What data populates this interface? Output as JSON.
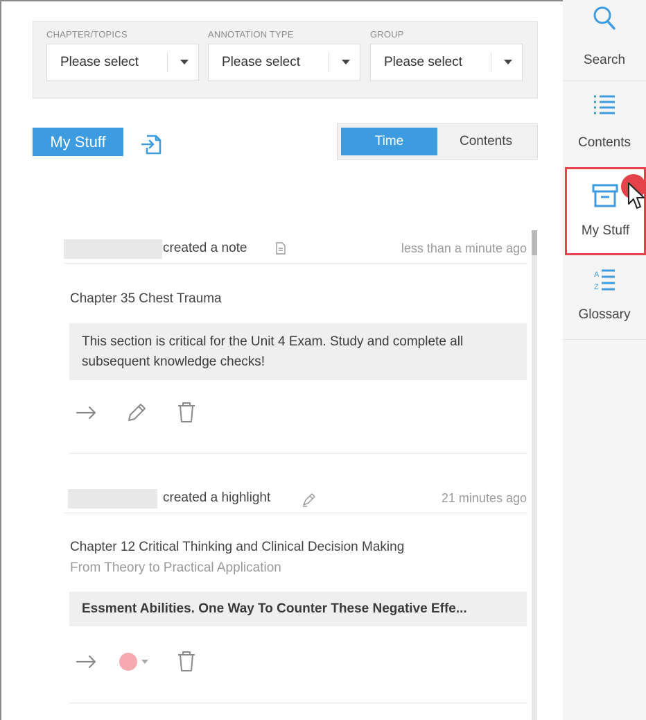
{
  "filters": [
    {
      "label": "CHAPTER/TOPICS",
      "value": "Please select"
    },
    {
      "label": "ANNOTATION TYPE",
      "value": "Please select"
    },
    {
      "label": "GROUP",
      "value": "Please select"
    }
  ],
  "header": {
    "mystuff_label": "My Stuff",
    "sort_time": "Time",
    "sort_contents": "Contents"
  },
  "entries": [
    {
      "action": "created a note",
      "time": "less than a minute ago",
      "chapter": "Chapter 35 Chest Trauma",
      "subtitle": "",
      "quote": "This section is critical for the Unit 4 Exam. Study and complete all subsequent knowledge checks!"
    },
    {
      "action": "created a highlight",
      "time": "21 minutes ago",
      "chapter": "Chapter 12 Critical Thinking and Clinical Decision Making",
      "subtitle": "From Theory to Practical Application",
      "quote": "Essment Abilities. One Way To Counter These Negative Effe..."
    }
  ],
  "rail": {
    "items": [
      {
        "label": "Search",
        "icon": "search-icon"
      },
      {
        "label": "Contents",
        "icon": "list-icon"
      },
      {
        "label": "My Stuff",
        "icon": "archive-box-icon"
      },
      {
        "label": "Glossary",
        "icon": "az-sort-icon"
      }
    ]
  },
  "colors": {
    "accent": "#3d9be0",
    "active_outline": "#e4434b",
    "highlight_pink": "#f7a9b2"
  }
}
